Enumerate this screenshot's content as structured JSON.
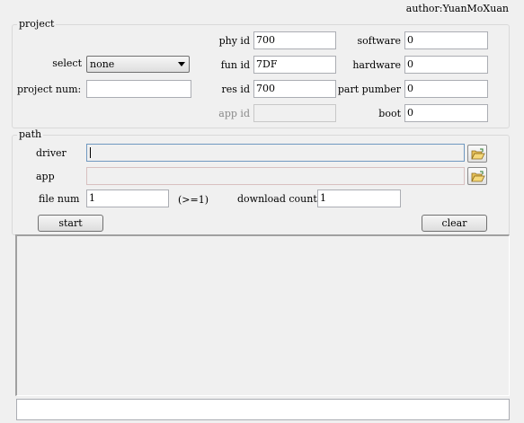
{
  "author": "author:YuanMoXuan",
  "project": {
    "legend": "project",
    "select_label": "select",
    "select_value": "none",
    "project_num_label": "project num:",
    "project_num_value": "",
    "phy_id_label": "phy id",
    "phy_id_value": "700",
    "fun_id_label": "fun id",
    "fun_id_value": "7DF",
    "res_id_label": "res id",
    "res_id_value": "700",
    "app_id_label": "app id",
    "app_id_value": "",
    "software_label": "software",
    "software_value": "0",
    "hardware_label": "hardware",
    "hardware_value": "0",
    "part_number_label": "part pumber",
    "part_number_value": "0",
    "boot_label": "boot",
    "boot_value": "0"
  },
  "path": {
    "legend": "path",
    "driver_label": "driver",
    "driver_value": "",
    "app_label": "app",
    "app_value": ""
  },
  "controls": {
    "file_num_label": "file num",
    "file_num_value": "1",
    "file_num_hint": "(>=1)",
    "download_count_label": "download count",
    "download_count_value": "1",
    "start_label": "start",
    "clear_label": "clear"
  },
  "log": {
    "text": ""
  },
  "status": {
    "text": ""
  },
  "colors": {
    "background": "#f0f0f0",
    "input_border": "#abadb3",
    "group_border": "#d9d9d9"
  },
  "icons": {
    "folder_button": "folder-open-icon"
  }
}
